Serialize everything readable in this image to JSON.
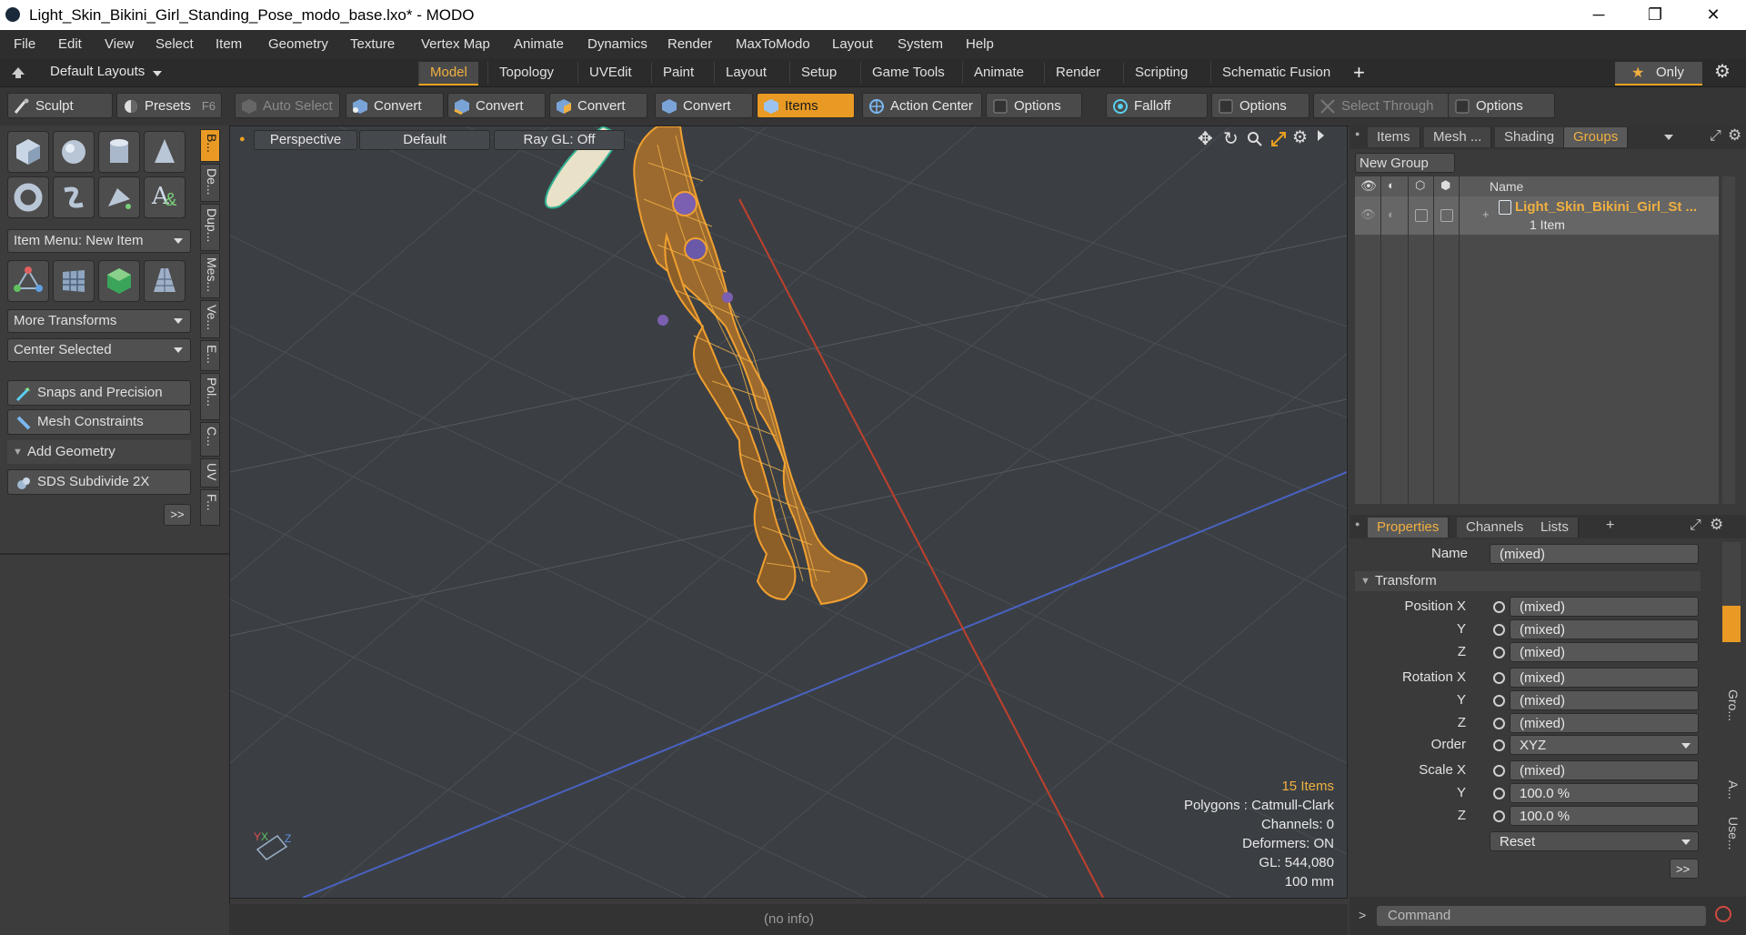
{
  "window": {
    "title": "Light_Skin_Bikini_Girl_Standing_Pose_modo_base.lxo* - MODO",
    "minimize": "─",
    "maximize": "❐",
    "close": "✕"
  },
  "menu": [
    "File",
    "Edit",
    "View",
    "Select",
    "Item",
    "Geometry",
    "Texture",
    "Vertex Map",
    "Animate",
    "Dynamics",
    "Render",
    "MaxToModo",
    "Layout",
    "System",
    "Help"
  ],
  "layouts": {
    "label": "Default Layouts"
  },
  "tabs": [
    "Model",
    "Topology",
    "UVEdit",
    "Paint",
    "Layout",
    "Setup",
    "Game Tools",
    "Animate",
    "Render",
    "Scripting",
    "Schematic Fusion"
  ],
  "only_label": "Only",
  "toolbar": {
    "sculpt": "Sculpt",
    "presets": "Presets",
    "presets_key": "F6",
    "auto_select": "Auto Select",
    "convert": "Convert",
    "items": "Items",
    "action_center": "Action Center",
    "options": "Options",
    "falloff": "Falloff",
    "select_through": "Select Through"
  },
  "left": {
    "item_menu": "Item Menu: New Item",
    "more_transforms": "More Transforms",
    "center_selected": "Center Selected",
    "snaps": "Snaps and Precision",
    "mesh_constraints": "Mesh Constraints",
    "add_geometry": "Add Geometry",
    "sds": "SDS Subdivide 2X",
    "more": ">>",
    "vtabs": [
      "B...",
      "De...",
      "Dup...",
      "Mes...",
      "Ve...",
      "E...",
      "Pol...",
      "C...",
      "UV",
      "F..."
    ]
  },
  "viewport": {
    "perspective": "Perspective",
    "default": "Default",
    "raygl": "Ray GL: Off",
    "items_count": "15 Items",
    "polygons": "Polygons : Catmull-Clark",
    "channels": "Channels: 0",
    "deformers": "Deformers: ON",
    "gl": "GL: 544,080",
    "scale": "100 mm",
    "axis_y": "Y",
    "axis_x": "X",
    "axis_z": "Z"
  },
  "status": "(no info)",
  "groups": {
    "tabs": [
      "Items",
      "Mesh ...",
      "Shading",
      "Groups"
    ],
    "new_group": "New Group",
    "name_col": "Name",
    "group_name": "Light_Skin_Bikini_Girl_St ...",
    "group_count": "1 Item"
  },
  "properties": {
    "tabs": [
      "Properties",
      "Channels",
      "Lists"
    ],
    "add_tab": "+",
    "name_label": "Name",
    "name_value": "(mixed)",
    "transform": "Transform",
    "position_x": "Position X",
    "y": "Y",
    "z": "Z",
    "rotation_x": "Rotation X",
    "order": "Order",
    "order_value": "XYZ",
    "scale_x": "Scale X",
    "mixed": "(mixed)",
    "scale_y": "100.0 %",
    "scale_z": "100.0 %",
    "reset": "Reset",
    "more": ">>",
    "side_tabs": [
      "Gro...",
      "A...",
      "Use..."
    ]
  },
  "command": {
    "placeholder": "Command",
    "prompt": ">"
  },
  "colors": {
    "accent": "#e89a24",
    "wire": "#f0a030"
  }
}
